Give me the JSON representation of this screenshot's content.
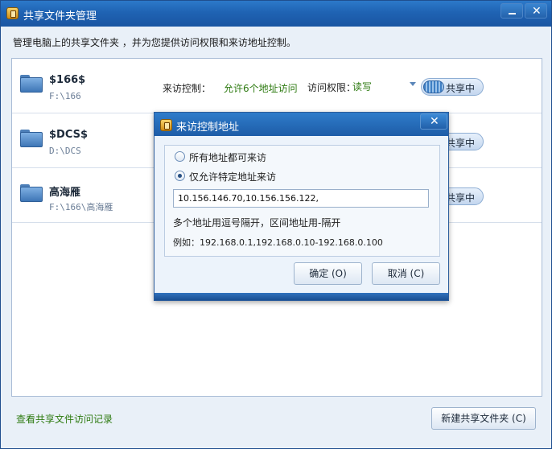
{
  "window": {
    "title": "共享文件夹管理",
    "description": "管理电脑上的共享文件夹 ，并为您提供访问权限和来访地址控制。"
  },
  "shares": [
    {
      "name": "$166$",
      "path": "F:\\166",
      "access_label": "来访控制：",
      "access_value": "允许6个地址访问",
      "perm_label": "访问权限：",
      "perm_value": "读写",
      "status": "共享中"
    },
    {
      "name": "$DCS$",
      "path": "D:\\DCS",
      "status": "共享中"
    },
    {
      "name": "高海雁",
      "path": "F:\\166\\高海雁",
      "status": "共享中"
    }
  ],
  "footer": {
    "history_link": "查看共享文件访问记录",
    "new_share_button": "新建共享文件夹 (C)"
  },
  "dialog": {
    "title": "来访控制地址",
    "option_all": "所有地址都可来访",
    "option_specific": "仅允许特定地址来访",
    "selected": "option_specific",
    "ip_value": "10.156.146.70,10.156.156.122,",
    "hint": "多个地址用逗号隔开，区间地址用-隔开",
    "example": "例如：192.168.0.1,192.168.0.10-192.168.0.100",
    "ok_button": "确定 (O)",
    "cancel_button": "取消 (C)"
  },
  "colors": {
    "titlebar": "#1f63b3",
    "green_text": "#2d7a10",
    "panel_bg": "#ffffff"
  }
}
